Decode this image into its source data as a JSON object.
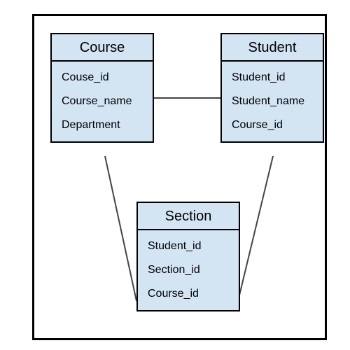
{
  "entities": [
    {
      "name": "Course",
      "attrs": [
        "Couse_id",
        "Course_name",
        "Department"
      ]
    },
    {
      "name": "Student",
      "attrs": [
        "Student_id",
        "Student_name",
        "Course_id"
      ]
    },
    {
      "name": "Section",
      "attrs": [
        "Student_id",
        "Section_id",
        "Course_id"
      ]
    }
  ],
  "relationships": [
    {
      "from": "Course",
      "to": "Student"
    },
    {
      "from": "Course",
      "to": "Section"
    },
    {
      "from": "Student",
      "to": "Section"
    }
  ],
  "colors": {
    "entity_fill": "#d3e4f3",
    "stroke": "#000000",
    "edge": "#444444"
  }
}
